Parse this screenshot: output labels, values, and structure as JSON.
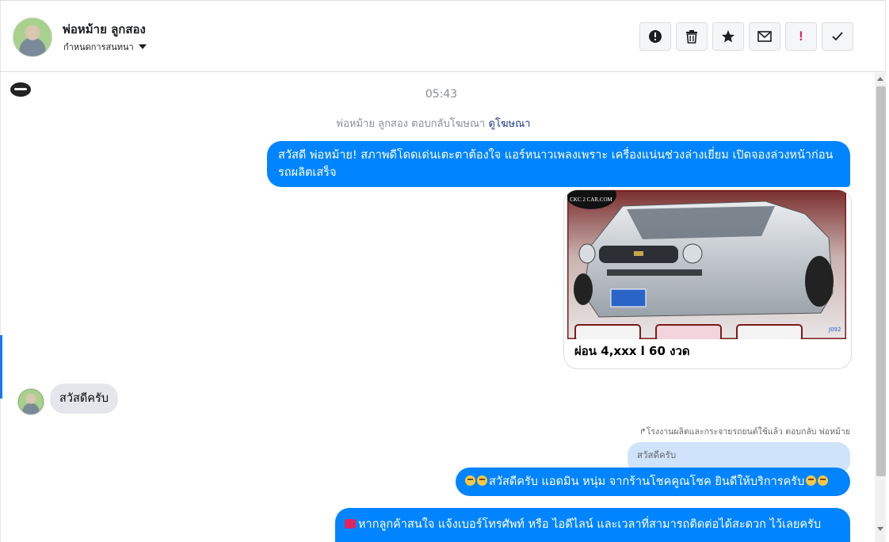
{
  "header": {
    "contact_name": "พ่อหม้าย ลูกสอง",
    "subtitle": "กำหนดการสนทนา",
    "actions": [
      {
        "name": "report-icon"
      },
      {
        "name": "trash-icon"
      },
      {
        "name": "star-icon"
      },
      {
        "name": "mail-icon"
      },
      {
        "name": "important-icon",
        "label": "!"
      },
      {
        "name": "check-icon"
      }
    ]
  },
  "chat": {
    "timestamp": "05:43",
    "ad_reply": {
      "text": "พ่อหม้าย ลูกสอง ตอบกลับโฆษณา",
      "link": "ดูโฆษณา"
    },
    "messages": [
      {
        "from": "page",
        "text": "สวัสดี พ่อหม้าย! สภาพดีโดดเด่นเตะตาต้องใจ แอร์หนาวเพลงเพราะ เครื่องแน่นช่วงล่างเยี่ยม เปิดจองล่วงหน้าก่อนรถผลิตเสร็จ"
      },
      {
        "from": "page",
        "type": "card",
        "title": "ผ่อน 4,xxx l 60 งวด",
        "image_watermark": "CKC 2 CAR.COM",
        "image_code": "J092"
      },
      {
        "from": "user",
        "text": "สวัสดีครับ"
      },
      {
        "from": "page",
        "reply_note": "โรงงานผลิตและกระจายรถยนต์ใช้แล้ว ตอบกลับ พ่อหม้าย",
        "quoted": "สวัสดีครับ",
        "text": "สวัสดีครับ แอดมิน หนุ่ม จากร้านโชคคูณโชค ยินดีให้บริการครับ"
      },
      {
        "from": "page",
        "text": "หากลูกค้าสนใจ แจ้งเบอร์โทรศัพท์ หรือ ไอดีไลน์ และเวลาที่สามารถติดต่อได้สะดวก ไว้เลยครับ"
      }
    ]
  },
  "colors": {
    "brand_blue": "#0084ff",
    "incoming_grey": "#e4e6eb",
    "important_red": "#e0245e"
  }
}
